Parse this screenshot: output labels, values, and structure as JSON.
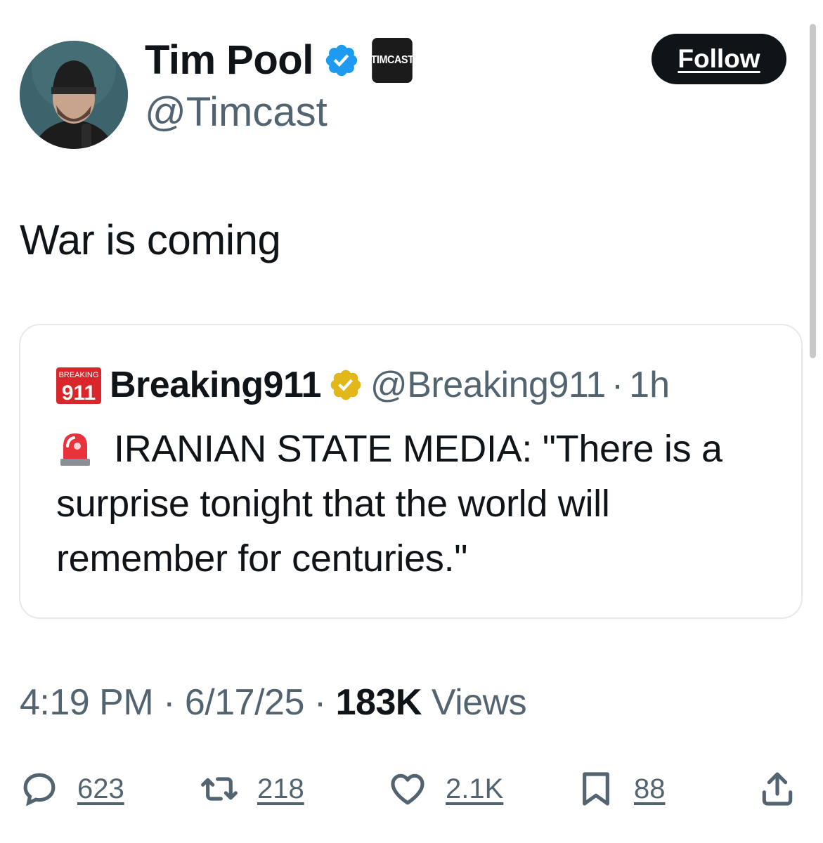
{
  "author": {
    "name": "Tim Pool",
    "handle": "@Timcast",
    "affiliate_badge_text": "TIMCAST"
  },
  "follow_label": "Follow",
  "tweet_text": "War is coming",
  "quote": {
    "logo_text_top": "BREAKING",
    "logo_text_bottom": "911",
    "name": "Breaking911",
    "handle": "@Breaking911",
    "separator": "·",
    "time": "1h",
    "text": "IRANIAN STATE MEDIA: \"There is a surprise tonight that the world will remember for centuries.\""
  },
  "meta": {
    "time": "4:19 PM",
    "date": "6/17/25",
    "separator": "·",
    "views_count": "183K",
    "views_label": "Views"
  },
  "actions": {
    "replies": "623",
    "reposts": "218",
    "likes": "2.1K",
    "bookmarks": "88"
  },
  "colors": {
    "text": "#0f1419",
    "secondary": "#536471",
    "verified_blue": "#1d9bf0",
    "verified_gold": "#e2b719",
    "logo_red": "#d9262b"
  },
  "icons": [
    "verified-blue-icon",
    "verified-gold-icon",
    "siren-icon",
    "reply-icon",
    "repost-icon",
    "like-icon",
    "bookmark-icon",
    "share-icon"
  ]
}
